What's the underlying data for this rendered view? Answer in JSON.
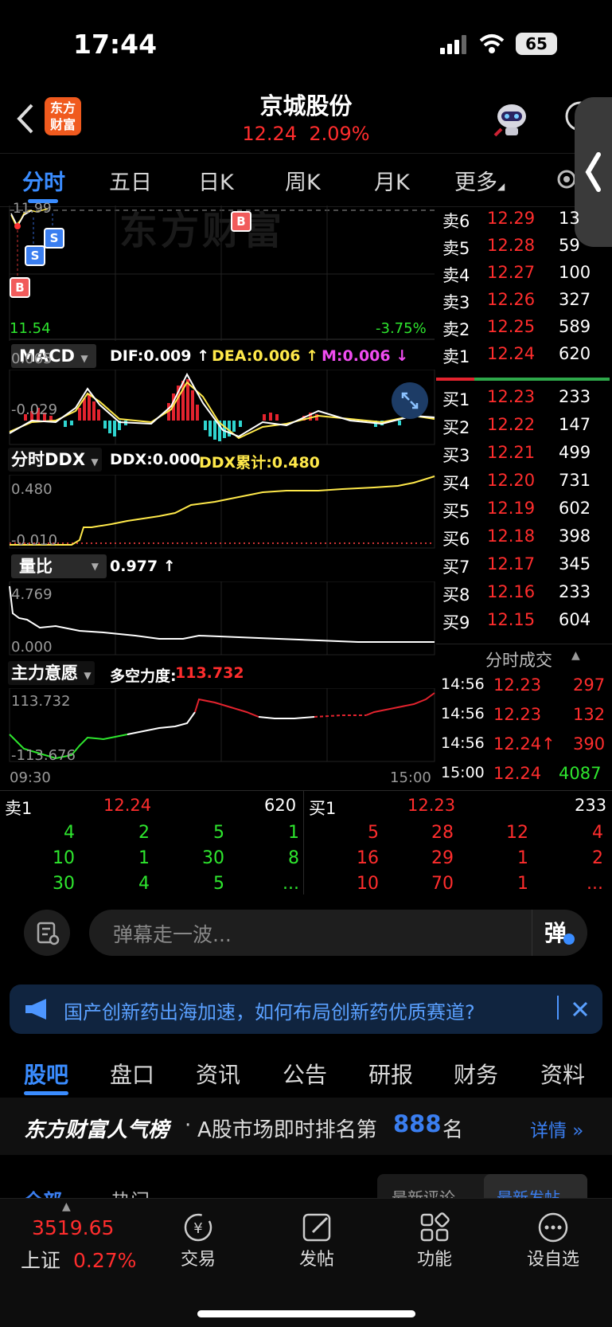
{
  "status": {
    "time": "17:44",
    "battery": "65"
  },
  "header": {
    "logo_line1": "东方",
    "logo_line2": "财富",
    "stock_name": "京城股份",
    "price": "12.24",
    "change_pct": "2.09%"
  },
  "tabs": [
    "分时",
    "五日",
    "日K",
    "周K",
    "月K",
    "更多"
  ],
  "chart": {
    "top_label": "11.99",
    "low_price": "11.54",
    "low_pct": "-3.75%",
    "watermark": "东方财富",
    "markers": [
      "B",
      "S",
      "S",
      "B",
      "B"
    ],
    "macd": {
      "name": "MACD",
      "dif": "DIF:0.009 ↑",
      "dea": "DEA:0.006 ↑",
      "m": "M:0.006 ↓",
      "ymax": "0.065",
      "ymin": "-0.029"
    },
    "ddx": {
      "name": "分时DDX",
      "ddx": "DDX:0.000",
      "sum": "DDX累计:0.480",
      "ymax": "0.480",
      "ymin": "-0.010"
    },
    "lb": {
      "name": "量比",
      "value": "0.977 ↑",
      "ymax": "4.769",
      "ymin": "0.000"
    },
    "zl": {
      "name": "主力意愿",
      "label": "多空力度:",
      "value": "113.732",
      "ymax": "113.732",
      "ymin": "-113.676",
      "t_start": "09:30",
      "t_end": "15:00"
    }
  },
  "book": {
    "sell": [
      {
        "label": "卖6",
        "price": "12.29",
        "vol": "13"
      },
      {
        "label": "卖5",
        "price": "12.28",
        "vol": "59"
      },
      {
        "label": "卖4",
        "price": "12.27",
        "vol": "100"
      },
      {
        "label": "卖3",
        "price": "12.26",
        "vol": "327"
      },
      {
        "label": "卖2",
        "price": "12.25",
        "vol": "589"
      },
      {
        "label": "卖1",
        "price": "12.24",
        "vol": "620"
      }
    ],
    "buy": [
      {
        "label": "买1",
        "price": "12.23",
        "vol": "233"
      },
      {
        "label": "买2",
        "price": "12.22",
        "vol": "147"
      },
      {
        "label": "买3",
        "price": "12.21",
        "vol": "499"
      },
      {
        "label": "买4",
        "price": "12.20",
        "vol": "731"
      },
      {
        "label": "买5",
        "price": "12.19",
        "vol": "602"
      },
      {
        "label": "买6",
        "price": "12.18",
        "vol": "398"
      },
      {
        "label": "买7",
        "price": "12.17",
        "vol": "345"
      },
      {
        "label": "买8",
        "price": "12.16",
        "vol": "233"
      },
      {
        "label": "买9",
        "price": "12.15",
        "vol": "604"
      }
    ],
    "ticks_title": "分时成交",
    "ticks": [
      {
        "time": "14:56",
        "price": "12.23",
        "vol": "297"
      },
      {
        "time": "14:56",
        "price": "12.23",
        "vol": "132"
      },
      {
        "time": "14:56",
        "price": "12.24↑",
        "vol": "390"
      },
      {
        "time": "15:00",
        "price": "12.24",
        "vol": "4087"
      }
    ]
  },
  "queue": {
    "sell_label": "卖1",
    "sell_price": "12.24",
    "sell_vol": "620",
    "buy_label": "买1",
    "buy_price": "12.23",
    "buy_vol": "233",
    "sell_rows": [
      [
        "4",
        "2",
        "5",
        "1"
      ],
      [
        "10",
        "1",
        "30",
        "8"
      ],
      [
        "30",
        "4",
        "5",
        "..."
      ]
    ],
    "buy_rows": [
      [
        "5",
        "28",
        "12",
        "4"
      ],
      [
        "16",
        "29",
        "1",
        "2"
      ],
      [
        "10",
        "70",
        "1",
        "..."
      ]
    ]
  },
  "danmu": {
    "placeholder": "弹幕走一波...",
    "send": "弹"
  },
  "banner": {
    "text": "国产创新药出海加速，如何布局创新药优质赛道?"
  },
  "subtabs": [
    "股吧",
    "盘口",
    "资讯",
    "公告",
    "研报",
    "财务",
    "资料"
  ],
  "rank": {
    "brand": "东方财富人气榜",
    "dot": "·",
    "text": "A股市场即时排名第",
    "num": "888",
    "unit": "名",
    "detail": "详情"
  },
  "peek": {
    "left": "全部",
    "mid": "热门",
    "r1": "最新评论",
    "r2": "最新发帖"
  },
  "bottom": {
    "index_value": "3519.65",
    "index_name": "上证",
    "index_pct": "0.27%",
    "items": [
      "交易",
      "发帖",
      "功能",
      "设自选"
    ]
  }
}
